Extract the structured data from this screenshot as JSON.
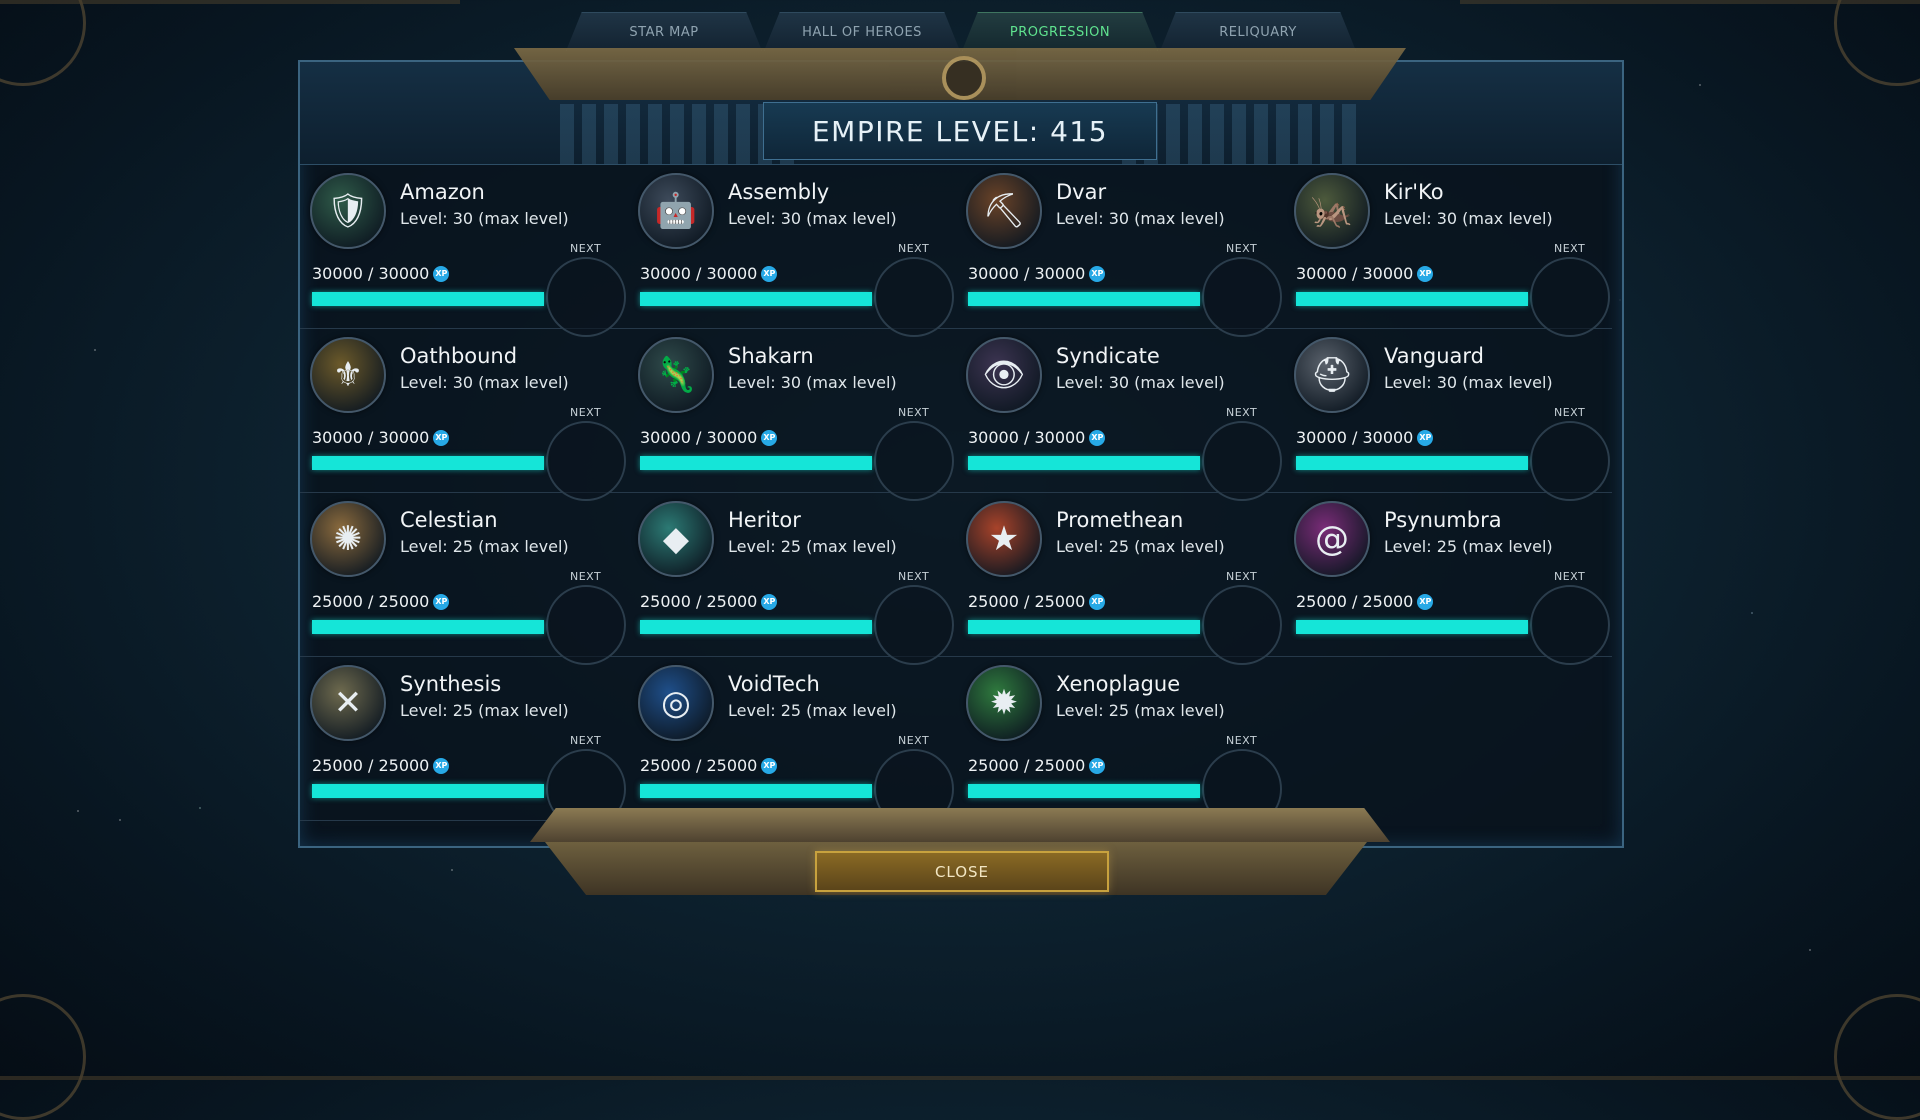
{
  "tabs": [
    {
      "label": "STAR MAP",
      "active": false
    },
    {
      "label": "HALL OF HEROES",
      "active": false
    },
    {
      "label": "PROGRESSION",
      "active": true
    },
    {
      "label": "RELIQUARY",
      "active": false
    }
  ],
  "header": {
    "title": "EMPIRE LEVEL: 415"
  },
  "next_label": "NEXT",
  "xp_icon_text": "XP",
  "factions": [
    {
      "name": "Amazon",
      "level": "Level: 30 (max level)",
      "xp": "30000 / 30000",
      "progress": 1.0,
      "icon": "amazon-portrait-icon",
      "glyph": "🛡",
      "color": "#2f5b49"
    },
    {
      "name": "Assembly",
      "level": "Level: 30 (max level)",
      "xp": "30000 / 30000",
      "progress": 1.0,
      "icon": "assembly-portrait-icon",
      "glyph": "🤖",
      "color": "#3d4a5a"
    },
    {
      "name": "Dvar",
      "level": "Level: 30 (max level)",
      "xp": "30000 / 30000",
      "progress": 1.0,
      "icon": "dvar-portrait-icon",
      "glyph": "⛏",
      "color": "#6a4328"
    },
    {
      "name": "Kir'Ko",
      "level": "Level: 30 (max level)",
      "xp": "30000 / 30000",
      "progress": 1.0,
      "icon": "kirko-portrait-icon",
      "glyph": "🦗",
      "color": "#4d5a3c"
    },
    {
      "name": "Oathbound",
      "level": "Level: 30 (max level)",
      "xp": "30000 / 30000",
      "progress": 1.0,
      "icon": "oathbound-portrait-icon",
      "glyph": "⚜",
      "color": "#6c5a2a"
    },
    {
      "name": "Shakarn",
      "level": "Level: 30 (max level)",
      "xp": "30000 / 30000",
      "progress": 1.0,
      "icon": "shakarn-portrait-icon",
      "glyph": "🦎",
      "color": "#2f4a4a"
    },
    {
      "name": "Syndicate",
      "level": "Level: 30 (max level)",
      "xp": "30000 / 30000",
      "progress": 1.0,
      "icon": "syndicate-portrait-icon",
      "glyph": "👁",
      "color": "#3c3451"
    },
    {
      "name": "Vanguard",
      "level": "Level: 30 (max level)",
      "xp": "30000 / 30000",
      "progress": 1.0,
      "icon": "vanguard-portrait-icon",
      "glyph": "⛑",
      "color": "#59616b"
    },
    {
      "name": "Celestian",
      "level": "Level: 25 (max level)",
      "xp": "25000 / 25000",
      "progress": 1.0,
      "icon": "celestian-emblem-icon",
      "glyph": "✺",
      "color": "#8a6a3d"
    },
    {
      "name": "Heritor",
      "level": "Level: 25 (max level)",
      "xp": "25000 / 25000",
      "progress": 1.0,
      "icon": "heritor-emblem-icon",
      "glyph": "◆",
      "color": "#2c7a74"
    },
    {
      "name": "Promethean",
      "level": "Level: 25 (max level)",
      "xp": "25000 / 25000",
      "progress": 1.0,
      "icon": "promethean-emblem-icon",
      "glyph": "★",
      "color": "#a8432a"
    },
    {
      "name": "Psynumbra",
      "level": "Level: 25 (max level)",
      "xp": "25000 / 25000",
      "progress": 1.0,
      "icon": "psynumbra-emblem-icon",
      "glyph": "@",
      "color": "#7a2c78"
    },
    {
      "name": "Synthesis",
      "level": "Level: 25 (max level)",
      "xp": "25000 / 25000",
      "progress": 1.0,
      "icon": "synthesis-emblem-icon",
      "glyph": "✕",
      "color": "#6e6a4e"
    },
    {
      "name": "VoidTech",
      "level": "Level: 25 (max level)",
      "xp": "25000 / 25000",
      "progress": 1.0,
      "icon": "voidtech-emblem-icon",
      "glyph": "◎",
      "color": "#1f4f8a"
    },
    {
      "name": "Xenoplague",
      "level": "Level: 25 (max level)",
      "xp": "25000 / 25000",
      "progress": 1.0,
      "icon": "xenoplague-emblem-icon",
      "glyph": "✹",
      "color": "#2f7a3e"
    }
  ],
  "close_label": "CLOSE",
  "colors": {
    "accent_bar": "#15e5d8",
    "active_tab": "#5fe38f",
    "close_border": "#c8a23e"
  }
}
